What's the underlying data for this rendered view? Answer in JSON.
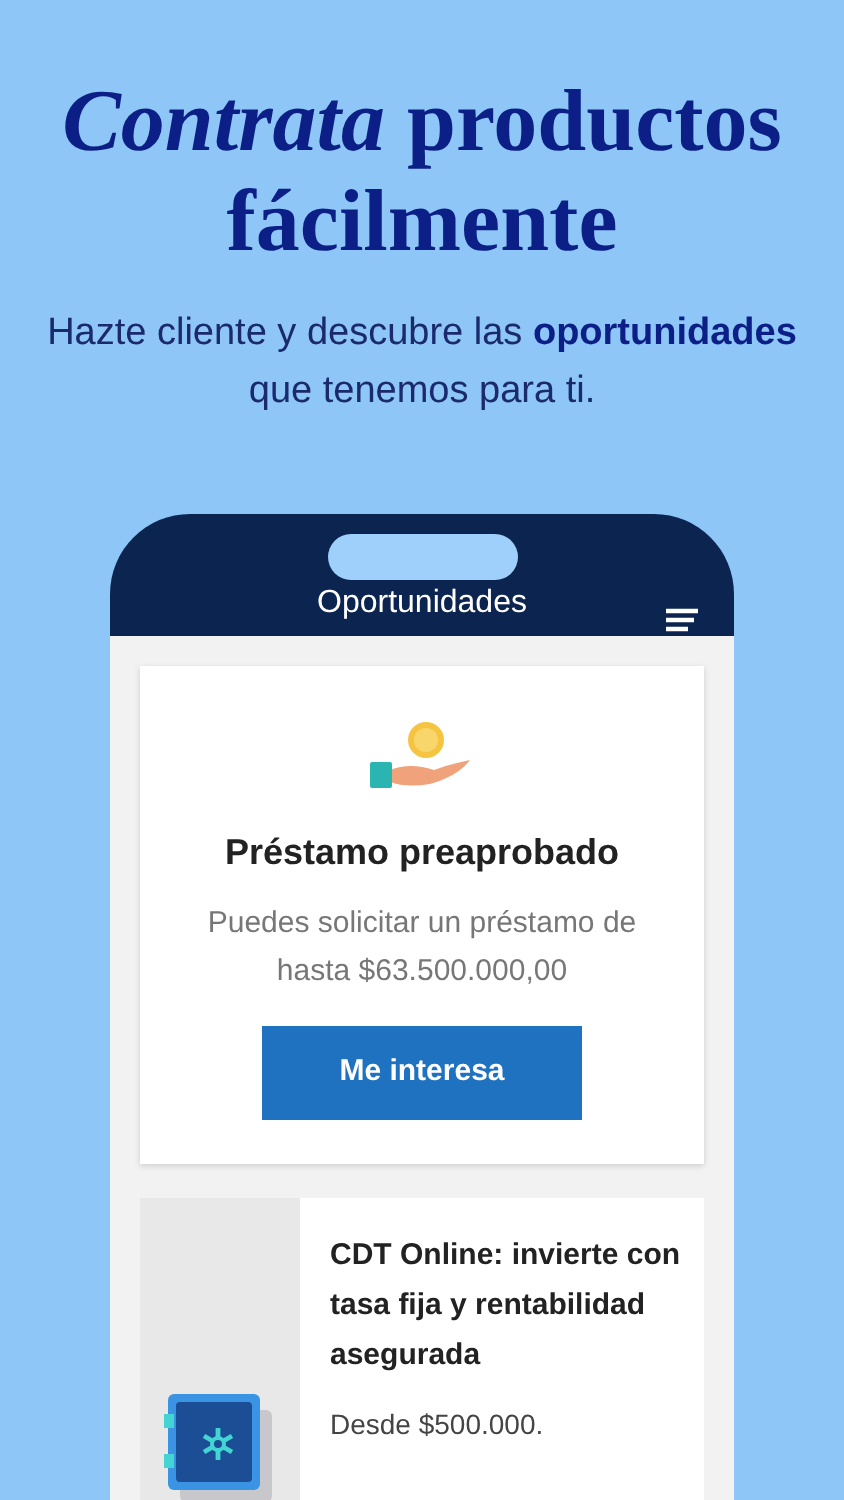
{
  "headline": "*Contrata* productos fácilmente",
  "subtitle": "Hazte cliente y descubre las **oportunidades** que tenemos para ti.",
  "phone": {
    "header_title": "Oportunidades",
    "cards": [
      {
        "kind": "offer",
        "title": "Préstamo preaprobado",
        "description": "Puedes solicitar un préstamo de hasta $63.500.000,00",
        "button": "Me interesa"
      },
      {
        "kind": "product",
        "title": "CDT Online: invierte con tasa fija y rentabilidad asegurada",
        "description": "Desde $500.000."
      }
    ]
  }
}
